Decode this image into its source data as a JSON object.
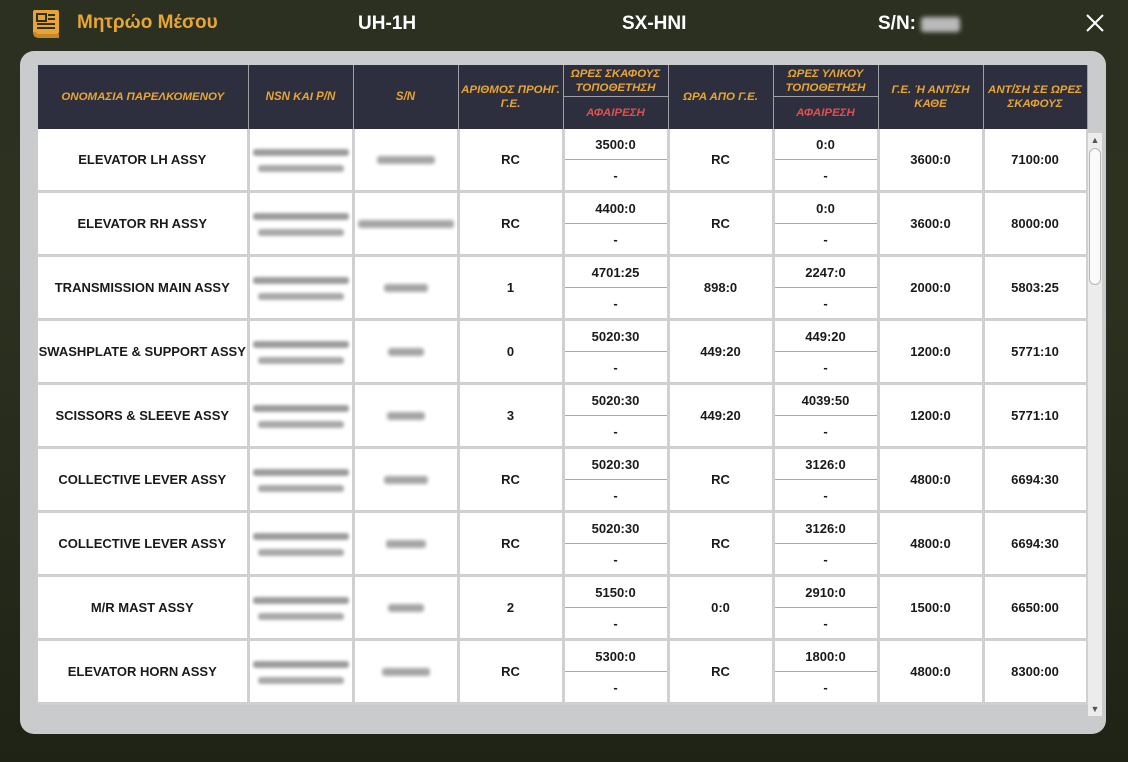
{
  "header": {
    "title": "Μητρώο Μέσου",
    "model": "UH-1H",
    "registration": "SX-HNI",
    "sn_label": "S/N:",
    "icon": "logbook-icon",
    "accent_color": "#e8a534"
  },
  "table": {
    "columns": {
      "name": "ΟΝΟΜΑΣΙΑ ΠΑΡΕΛΚΟΜΕΝΟΥ",
      "nsn": "NSN ΚΑΙ P/N",
      "sn": "S/N",
      "prev_overhauls": "ΑΡΙΘΜΟΣ ΠΡΟΗΓ. Γ.Ε.",
      "aircraft_hours": "ΩΡΕΣ ΣΚΑΦΟΥΣ ΤΟΠΟΘΕΤΗΣΗ",
      "aircraft_hours_removal": "ΑΦΑΙΡΕΣΗ",
      "hours_since_overhaul": "ΩΡΑ ΑΠΟ Γ.Ε.",
      "material_hours": "ΩΡΕΣ ΥΛΙΚΟΥ ΤΟΠΟΘΕΤΗΣΗ",
      "material_hours_removal": "ΑΦΑΙΡΕΣΗ",
      "overhaul_interval": "Γ.Ε. Ή ΑΝΤ/ΣΗ ΚΑΘΕ",
      "replacement_at": "ΑΝΤ/ΣΗ ΣΕ ΩΡΕΣ ΣΚΑΦΟΥΣ"
    },
    "rows": [
      {
        "name": "ELEVATOR LH ASSY",
        "prev": "RC",
        "ac_install": "3500:0",
        "ac_remove": "-",
        "since_oh": "RC",
        "mat_install": "0:0",
        "mat_remove": "-",
        "interval": "3600:0",
        "replace_at": "7100:00"
      },
      {
        "name": "ELEVATOR RH ASSY",
        "prev": "RC",
        "ac_install": "4400:0",
        "ac_remove": "-",
        "since_oh": "RC",
        "mat_install": "0:0",
        "mat_remove": "-",
        "interval": "3600:0",
        "replace_at": "8000:00"
      },
      {
        "name": "TRANSMISSION MAIN ASSY",
        "prev": "1",
        "ac_install": "4701:25",
        "ac_remove": "-",
        "since_oh": "898:0",
        "mat_install": "2247:0",
        "mat_remove": "-",
        "interval": "2000:0",
        "replace_at": "5803:25"
      },
      {
        "name": "SWASHPLATE & SUPPORT ASSY",
        "prev": "0",
        "ac_install": "5020:30",
        "ac_remove": "-",
        "since_oh": "449:20",
        "mat_install": "449:20",
        "mat_remove": "-",
        "interval": "1200:0",
        "replace_at": "5771:10"
      },
      {
        "name": "SCISSORS & SLEEVE ASSY",
        "prev": "3",
        "ac_install": "5020:30",
        "ac_remove": "-",
        "since_oh": "449:20",
        "mat_install": "4039:50",
        "mat_remove": "-",
        "interval": "1200:0",
        "replace_at": "5771:10"
      },
      {
        "name": "COLLECTIVE LEVER ASSY",
        "prev": "RC",
        "ac_install": "5020:30",
        "ac_remove": "-",
        "since_oh": "RC",
        "mat_install": "3126:0",
        "mat_remove": "-",
        "interval": "4800:0",
        "replace_at": "6694:30"
      },
      {
        "name": "COLLECTIVE LEVER ASSY",
        "prev": "RC",
        "ac_install": "5020:30",
        "ac_remove": "-",
        "since_oh": "RC",
        "mat_install": "3126:0",
        "mat_remove": "-",
        "interval": "4800:0",
        "replace_at": "6694:30"
      },
      {
        "name": "M/R MAST ASSY",
        "prev": "2",
        "ac_install": "5150:0",
        "ac_remove": "-",
        "since_oh": "0:0",
        "mat_install": "2910:0",
        "mat_remove": "-",
        "interval": "1500:0",
        "replace_at": "6650:00"
      },
      {
        "name": "ELEVATOR HORN ASSY",
        "prev": "RC",
        "ac_install": "5300:0",
        "ac_remove": "-",
        "since_oh": "RC",
        "mat_install": "1800:0",
        "mat_remove": "-",
        "interval": "4800:0",
        "replace_at": "8300:00"
      }
    ]
  },
  "scrollbar": {
    "up": "▲",
    "down": "▼"
  }
}
